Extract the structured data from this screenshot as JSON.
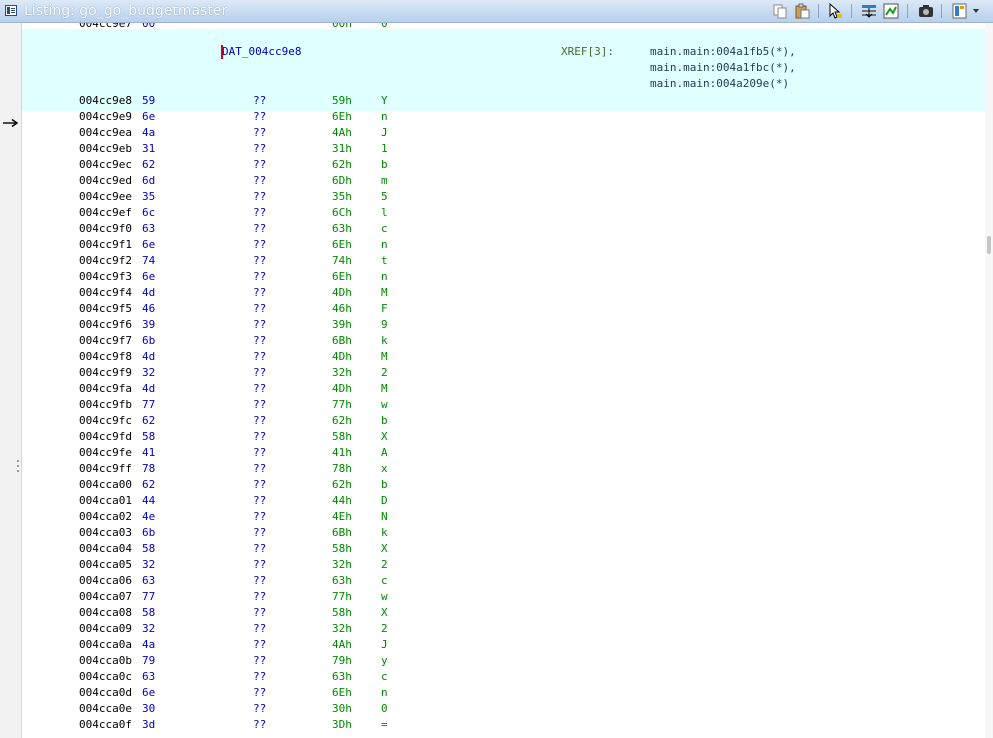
{
  "window": {
    "title": "Listing: go_go_budgetmaster",
    "toolbar": [
      {
        "name": "copy-icon"
      },
      {
        "name": "paste-icon"
      },
      {
        "name": "cursor-select-icon"
      },
      {
        "name": "field-navigate-icon"
      },
      {
        "name": "diff-icon"
      },
      {
        "name": "snapshot-icon"
      },
      {
        "name": "display-options-icon"
      },
      {
        "name": "dropdown-arrow-icon"
      }
    ]
  },
  "listing": {
    "label": "DAT_004cc9e8",
    "xref_label": "XREF[3]:",
    "xrefs": [
      "main.main:004a1fb5(*),",
      "main.main:004a1fbc(*),",
      "main.main:004a209e(*)"
    ],
    "partial_top": {
      "addr": "004cc9e7",
      "byte": "00",
      "hex": "00h",
      "char": "0"
    },
    "rows": [
      {
        "addr": "004cc9e8",
        "byte": "59",
        "mnem": "??",
        "hex": "59h",
        "char": "Y"
      },
      {
        "addr": "004cc9e9",
        "byte": "6e",
        "mnem": "??",
        "hex": "6Eh",
        "char": "n"
      },
      {
        "addr": "004cc9ea",
        "byte": "4a",
        "mnem": "??",
        "hex": "4Ah",
        "char": "J"
      },
      {
        "addr": "004cc9eb",
        "byte": "31",
        "mnem": "??",
        "hex": "31h",
        "char": "1"
      },
      {
        "addr": "004cc9ec",
        "byte": "62",
        "mnem": "??",
        "hex": "62h",
        "char": "b"
      },
      {
        "addr": "004cc9ed",
        "byte": "6d",
        "mnem": "??",
        "hex": "6Dh",
        "char": "m"
      },
      {
        "addr": "004cc9ee",
        "byte": "35",
        "mnem": "??",
        "hex": "35h",
        "char": "5"
      },
      {
        "addr": "004cc9ef",
        "byte": "6c",
        "mnem": "??",
        "hex": "6Ch",
        "char": "l"
      },
      {
        "addr": "004cc9f0",
        "byte": "63",
        "mnem": "??",
        "hex": "63h",
        "char": "c"
      },
      {
        "addr": "004cc9f1",
        "byte": "6e",
        "mnem": "??",
        "hex": "6Eh",
        "char": "n"
      },
      {
        "addr": "004cc9f2",
        "byte": "74",
        "mnem": "??",
        "hex": "74h",
        "char": "t"
      },
      {
        "addr": "004cc9f3",
        "byte": "6e",
        "mnem": "??",
        "hex": "6Eh",
        "char": "n"
      },
      {
        "addr": "004cc9f4",
        "byte": "4d",
        "mnem": "??",
        "hex": "4Dh",
        "char": "M"
      },
      {
        "addr": "004cc9f5",
        "byte": "46",
        "mnem": "??",
        "hex": "46h",
        "char": "F"
      },
      {
        "addr": "004cc9f6",
        "byte": "39",
        "mnem": "??",
        "hex": "39h",
        "char": "9"
      },
      {
        "addr": "004cc9f7",
        "byte": "6b",
        "mnem": "??",
        "hex": "6Bh",
        "char": "k"
      },
      {
        "addr": "004cc9f8",
        "byte": "4d",
        "mnem": "??",
        "hex": "4Dh",
        "char": "M"
      },
      {
        "addr": "004cc9f9",
        "byte": "32",
        "mnem": "??",
        "hex": "32h",
        "char": "2"
      },
      {
        "addr": "004cc9fa",
        "byte": "4d",
        "mnem": "??",
        "hex": "4Dh",
        "char": "M"
      },
      {
        "addr": "004cc9fb",
        "byte": "77",
        "mnem": "??",
        "hex": "77h",
        "char": "w"
      },
      {
        "addr": "004cc9fc",
        "byte": "62",
        "mnem": "??",
        "hex": "62h",
        "char": "b"
      },
      {
        "addr": "004cc9fd",
        "byte": "58",
        "mnem": "??",
        "hex": "58h",
        "char": "X"
      },
      {
        "addr": "004cc9fe",
        "byte": "41",
        "mnem": "??",
        "hex": "41h",
        "char": "A"
      },
      {
        "addr": "004cc9ff",
        "byte": "78",
        "mnem": "??",
        "hex": "78h",
        "char": "x"
      },
      {
        "addr": "004cca00",
        "byte": "62",
        "mnem": "??",
        "hex": "62h",
        "char": "b"
      },
      {
        "addr": "004cca01",
        "byte": "44",
        "mnem": "??",
        "hex": "44h",
        "char": "D"
      },
      {
        "addr": "004cca02",
        "byte": "4e",
        "mnem": "??",
        "hex": "4Eh",
        "char": "N"
      },
      {
        "addr": "004cca03",
        "byte": "6b",
        "mnem": "??",
        "hex": "6Bh",
        "char": "k"
      },
      {
        "addr": "004cca04",
        "byte": "58",
        "mnem": "??",
        "hex": "58h",
        "char": "X"
      },
      {
        "addr": "004cca05",
        "byte": "32",
        "mnem": "??",
        "hex": "32h",
        "char": "2"
      },
      {
        "addr": "004cca06",
        "byte": "63",
        "mnem": "??",
        "hex": "63h",
        "char": "c"
      },
      {
        "addr": "004cca07",
        "byte": "77",
        "mnem": "??",
        "hex": "77h",
        "char": "w"
      },
      {
        "addr": "004cca08",
        "byte": "58",
        "mnem": "??",
        "hex": "58h",
        "char": "X"
      },
      {
        "addr": "004cca09",
        "byte": "32",
        "mnem": "??",
        "hex": "32h",
        "char": "2"
      },
      {
        "addr": "004cca0a",
        "byte": "4a",
        "mnem": "??",
        "hex": "4Ah",
        "char": "J"
      },
      {
        "addr": "004cca0b",
        "byte": "79",
        "mnem": "??",
        "hex": "79h",
        "char": "y"
      },
      {
        "addr": "004cca0c",
        "byte": "63",
        "mnem": "??",
        "hex": "63h",
        "char": "c"
      },
      {
        "addr": "004cca0d",
        "byte": "6e",
        "mnem": "??",
        "hex": "6Eh",
        "char": "n"
      },
      {
        "addr": "004cca0e",
        "byte": "30",
        "mnem": "??",
        "hex": "30h",
        "char": "0"
      },
      {
        "addr": "004cca0f",
        "byte": "3d",
        "mnem": "??",
        "hex": "3Dh",
        "char": "="
      }
    ]
  },
  "colors": {
    "highlight": "#e0ffff",
    "address": "#000000",
    "byte": "#0000c8",
    "value": "#008800",
    "label": "#0000c0",
    "caret": "#e00000"
  }
}
